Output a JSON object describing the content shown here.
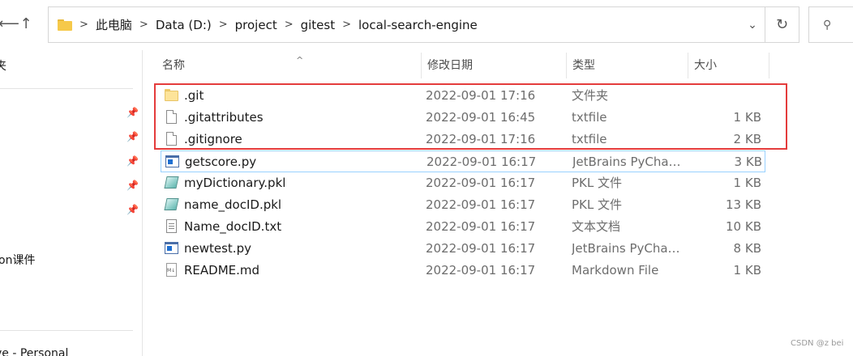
{
  "nav": {
    "back_icon": "arrow-left-icon",
    "up_icon": "arrow-up-icon"
  },
  "address": {
    "breadcrumbs": [
      "此电脑",
      "Data (D:)",
      "project",
      "gitest",
      "local-search-engine"
    ],
    "separator": ">",
    "dropdown_icon": "chevron-down-icon",
    "refresh_icon": "refresh-icon"
  },
  "search": {
    "icon": "search-icon"
  },
  "navpane": {
    "items": [
      {
        "label": "夹"
      },
      {
        "label": "on课件"
      },
      {
        "label": "ve - Personal"
      }
    ],
    "pinned_count": 5
  },
  "columns": {
    "name": "名称",
    "date": "修改日期",
    "type": "类型",
    "size": "大小"
  },
  "files": [
    {
      "name": ".git",
      "date": "2022-09-01 17:16",
      "type": "文件夹",
      "size": "",
      "icon": "folder-icon"
    },
    {
      "name": ".gitattributes",
      "date": "2022-09-01 16:45",
      "type": "txtfile",
      "size": "1 KB",
      "icon": "file-icon"
    },
    {
      "name": ".gitignore",
      "date": "2022-09-01 17:16",
      "type": "txtfile",
      "size": "2 KB",
      "icon": "file-icon"
    },
    {
      "name": "getscore.py",
      "date": "2022-09-01 16:17",
      "type": "JetBrains PyChar...",
      "size": "3 KB",
      "icon": "python-file-icon"
    },
    {
      "name": "myDictionary.pkl",
      "date": "2022-09-01 16:17",
      "type": "PKL 文件",
      "size": "1 KB",
      "icon": "pkl-file-icon"
    },
    {
      "name": "name_docID.pkl",
      "date": "2022-09-01 16:17",
      "type": "PKL 文件",
      "size": "13 KB",
      "icon": "pkl-file-icon"
    },
    {
      "name": "Name_docID.txt",
      "date": "2022-09-01 16:17",
      "type": "文本文档",
      "size": "10 KB",
      "icon": "text-file-icon"
    },
    {
      "name": "newtest.py",
      "date": "2022-09-01 16:17",
      "type": "JetBrains PyChar...",
      "size": "8 KB",
      "icon": "python-file-icon"
    },
    {
      "name": "README.md",
      "date": "2022-09-01 16:17",
      "type": "Markdown File",
      "size": "1 KB",
      "icon": "markdown-file-icon"
    }
  ],
  "colors": {
    "highlight": "#e43c3c",
    "hover_border": "#99d1ff",
    "folder": "#f6c94a"
  },
  "watermark": "CSDN @z bei"
}
